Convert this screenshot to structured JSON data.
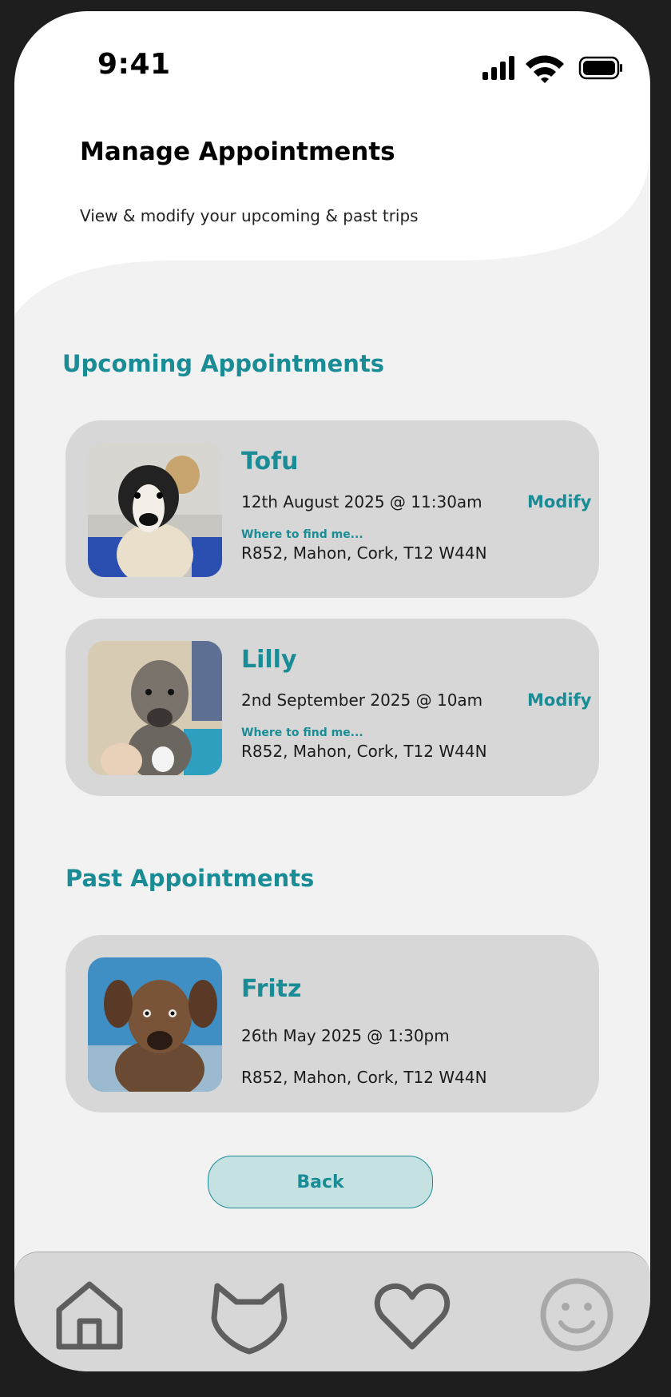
{
  "status_bar": {
    "time": "9:41",
    "icons": [
      "signal-icon",
      "wifi-icon",
      "battery-icon"
    ]
  },
  "header": {
    "title": "Manage Appointments",
    "subtitle": "View & modify your upcoming & past trips"
  },
  "upcoming": {
    "title": "Upcoming Appointments",
    "items": [
      {
        "name": "Tofu",
        "datetime": "12th August 2025 @ 11:30am",
        "where_label": "Where to find me...",
        "address": "R852, Mahon, Cork, T12 W44N",
        "action": "Modify"
      },
      {
        "name": "Lilly",
        "datetime": "2nd September 2025 @ 10am",
        "where_label": "Where to find me...",
        "address": "R852, Mahon, Cork, T12 W44N",
        "action": "Modify"
      }
    ]
  },
  "past": {
    "title": "Past Appointments",
    "items": [
      {
        "name": "Fritz",
        "datetime": "26th May 2025 @ 1:30pm",
        "address": "R852, Mahon, Cork, T12 W44N"
      }
    ]
  },
  "back_button": {
    "label": "Back"
  },
  "tab_bar": {
    "items": [
      "home-icon",
      "cat-icon",
      "heart-icon",
      "smiley-icon"
    ]
  },
  "colors": {
    "accent": "#1a8c96",
    "card": "#d7d7d7",
    "background": "#f2f2f2",
    "button_fill": "#c5e1e2"
  }
}
